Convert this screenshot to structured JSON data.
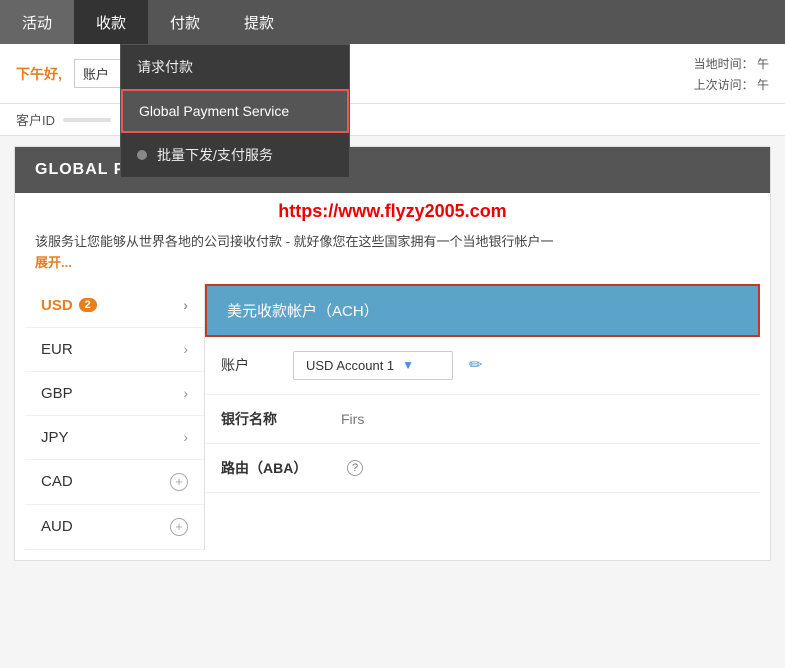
{
  "nav": {
    "items": [
      {
        "id": "activity",
        "label": "活动"
      },
      {
        "id": "receive",
        "label": "收款",
        "active": true
      },
      {
        "id": "pay",
        "label": "付款"
      },
      {
        "id": "withdraw",
        "label": "提款"
      }
    ]
  },
  "dropdown": {
    "items": [
      {
        "id": "request-payment",
        "label": "请求付款",
        "icon": false
      },
      {
        "id": "global-payment",
        "label": "Global Payment Service",
        "icon": false,
        "highlighted": true
      },
      {
        "id": "batch-service",
        "label": "批量下发/支付服务",
        "icon": true
      }
    ]
  },
  "info_bar": {
    "afternoon_label": "下午好,",
    "account_placeholder": "账户",
    "local_time_label": "当地时间：",
    "local_time_value": "午",
    "last_visit_label": "上次访问：",
    "last_visit_value": "午"
  },
  "customer": {
    "label": "客户ID",
    "value": ""
  },
  "watermark": {
    "url": "https://www.flyzy2005.com"
  },
  "gps_section": {
    "header": "GLOBAL PAYMENT SERVICE",
    "description": "该服务让您能够从世界各地的公司接收付款 - 就好像您在这些国家拥有一个当地银行帐户一",
    "expand_label": "展开..."
  },
  "currencies": [
    {
      "id": "USD",
      "label": "USD",
      "badge": "2",
      "active": true,
      "has_plus": false
    },
    {
      "id": "EUR",
      "label": "EUR",
      "active": false,
      "has_plus": false
    },
    {
      "id": "GBP",
      "label": "GBP",
      "active": false,
      "has_plus": false
    },
    {
      "id": "JPY",
      "label": "JPY",
      "active": false,
      "has_plus": false
    },
    {
      "id": "CAD",
      "label": "CAD",
      "active": false,
      "has_plus": true
    },
    {
      "id": "AUD",
      "label": "AUD",
      "active": false,
      "has_plus": true
    }
  ],
  "account_panel": {
    "header": "美元收款帐户（ACH）",
    "account_label": "账户",
    "account_value": "USD Account 1",
    "bank_name_label": "银行名称",
    "bank_name_value": "Firs",
    "routing_label": "路由（ABA）"
  }
}
